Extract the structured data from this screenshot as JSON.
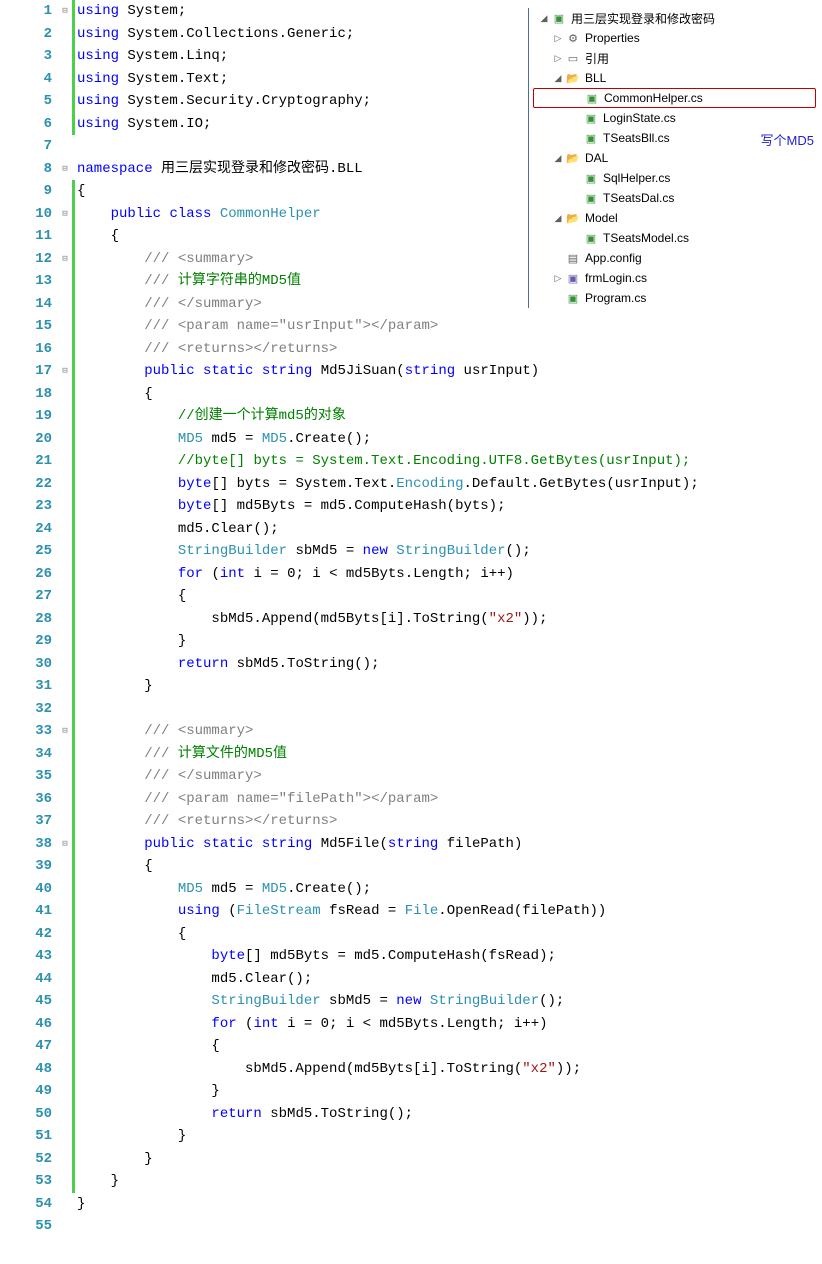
{
  "annotation": "写个MD5",
  "solution": {
    "project": "用三层实现登录和修改密码",
    "properties": "Properties",
    "references": "引用",
    "bll": "BLL",
    "bll_files": {
      "common_helper": "CommonHelper.cs",
      "login_state": "LoginState.cs",
      "tseats_bll": "TSeatsBll.cs"
    },
    "dal": "DAL",
    "dal_files": {
      "sql_helper": "SqlHelper.cs",
      "tseats_dal": "TSeatsDal.cs"
    },
    "model": "Model",
    "model_files": {
      "tseats_model": "TSeatsModel.cs"
    },
    "app_config": "App.config",
    "frm_login": "frmLogin.cs",
    "program": "Program.cs"
  },
  "code": {
    "lines": [
      {
        "n": 1,
        "fold": "⊟",
        "mod": true,
        "segs": [
          {
            "t": "using",
            "c": "kw"
          },
          {
            "t": " System;"
          }
        ]
      },
      {
        "n": 2,
        "fold": "│",
        "mod": true,
        "segs": [
          {
            "t": "using",
            "c": "kw"
          },
          {
            "t": " System.Collections.Generic;"
          }
        ]
      },
      {
        "n": 3,
        "fold": "│",
        "mod": true,
        "segs": [
          {
            "t": "using",
            "c": "kw"
          },
          {
            "t": " System.Linq;"
          }
        ]
      },
      {
        "n": 4,
        "fold": "│",
        "mod": true,
        "segs": [
          {
            "t": "using",
            "c": "kw"
          },
          {
            "t": " System.Text;"
          }
        ]
      },
      {
        "n": 5,
        "fold": "│",
        "mod": true,
        "segs": [
          {
            "t": "using",
            "c": "kw"
          },
          {
            "t": " System.Security.Cryptography;"
          }
        ]
      },
      {
        "n": 6,
        "fold": "└",
        "mod": true,
        "segs": [
          {
            "t": "using",
            "c": "kw"
          },
          {
            "t": " System.IO;"
          }
        ]
      },
      {
        "n": 7,
        "fold": "",
        "mod": false,
        "segs": []
      },
      {
        "n": 8,
        "fold": "⊟",
        "mod": false,
        "segs": [
          {
            "t": "namespace",
            "c": "kw"
          },
          {
            "t": " 用三层实现登录和修改密码.BLL"
          }
        ]
      },
      {
        "n": 9,
        "fold": "│",
        "mod": true,
        "segs": [
          {
            "t": "{"
          }
        ]
      },
      {
        "n": 10,
        "fold": "⊟",
        "mod": true,
        "segs": [
          {
            "t": "    "
          },
          {
            "t": "public",
            "c": "kw"
          },
          {
            "t": " "
          },
          {
            "t": "class",
            "c": "kw"
          },
          {
            "t": " "
          },
          {
            "t": "CommonHelper",
            "c": "type"
          }
        ]
      },
      {
        "n": 11,
        "fold": "│",
        "mod": true,
        "segs": [
          {
            "t": "    {"
          }
        ]
      },
      {
        "n": 12,
        "fold": "⊟",
        "mod": true,
        "segs": [
          {
            "t": "        "
          },
          {
            "t": "/// ",
            "c": "doc"
          },
          {
            "t": "<summary>",
            "c": "doc"
          }
        ]
      },
      {
        "n": 13,
        "fold": "│",
        "mod": true,
        "segs": [
          {
            "t": "        "
          },
          {
            "t": "/// ",
            "c": "doc"
          },
          {
            "t": "计算字符串的MD5值",
            "c": "cmt"
          }
        ]
      },
      {
        "n": 14,
        "fold": "│",
        "mod": true,
        "segs": [
          {
            "t": "        "
          },
          {
            "t": "/// ",
            "c": "doc"
          },
          {
            "t": "</summary>",
            "c": "doc"
          }
        ]
      },
      {
        "n": 15,
        "fold": "│",
        "mod": true,
        "segs": [
          {
            "t": "        "
          },
          {
            "t": "/// ",
            "c": "doc"
          },
          {
            "t": "<param name=\"",
            "c": "doc"
          },
          {
            "t": "usrInput",
            "c": "doc"
          },
          {
            "t": "\"></param>",
            "c": "doc"
          }
        ]
      },
      {
        "n": 16,
        "fold": "└",
        "mod": true,
        "segs": [
          {
            "t": "        "
          },
          {
            "t": "/// ",
            "c": "doc"
          },
          {
            "t": "<returns></returns>",
            "c": "doc"
          }
        ]
      },
      {
        "n": 17,
        "fold": "⊟",
        "mod": true,
        "segs": [
          {
            "t": "        "
          },
          {
            "t": "public",
            "c": "kw"
          },
          {
            "t": " "
          },
          {
            "t": "static",
            "c": "kw"
          },
          {
            "t": " "
          },
          {
            "t": "string",
            "c": "kw"
          },
          {
            "t": " Md5JiSuan("
          },
          {
            "t": "string",
            "c": "kw"
          },
          {
            "t": " usrInput)"
          }
        ]
      },
      {
        "n": 18,
        "fold": "│",
        "mod": true,
        "segs": [
          {
            "t": "        {"
          }
        ]
      },
      {
        "n": 19,
        "fold": "│",
        "mod": true,
        "segs": [
          {
            "t": "            "
          },
          {
            "t": "//创建一个计算md5的对象",
            "c": "cmt"
          }
        ]
      },
      {
        "n": 20,
        "fold": "│",
        "mod": true,
        "segs": [
          {
            "t": "            "
          },
          {
            "t": "MD5",
            "c": "type"
          },
          {
            "t": " md5 = "
          },
          {
            "t": "MD5",
            "c": "type"
          },
          {
            "t": ".Create();"
          }
        ]
      },
      {
        "n": 21,
        "fold": "│",
        "mod": true,
        "segs": [
          {
            "t": "            "
          },
          {
            "t": "//byte[] byts = System.Text.Encoding.UTF8.GetBytes(usrInput);",
            "c": "cmt"
          }
        ]
      },
      {
        "n": 22,
        "fold": "│",
        "mod": true,
        "segs": [
          {
            "t": "            "
          },
          {
            "t": "byte",
            "c": "kw"
          },
          {
            "t": "[] byts = System.Text."
          },
          {
            "t": "Encoding",
            "c": "type"
          },
          {
            "t": ".Default.GetBytes(usrInput);"
          }
        ]
      },
      {
        "n": 23,
        "fold": "│",
        "mod": true,
        "segs": [
          {
            "t": "            "
          },
          {
            "t": "byte",
            "c": "kw"
          },
          {
            "t": "[] md5Byts = md5.ComputeHash(byts);"
          }
        ]
      },
      {
        "n": 24,
        "fold": "│",
        "mod": true,
        "segs": [
          {
            "t": "            md5.Clear();"
          }
        ]
      },
      {
        "n": 25,
        "fold": "│",
        "mod": true,
        "segs": [
          {
            "t": "            "
          },
          {
            "t": "StringBuilder",
            "c": "type"
          },
          {
            "t": " sbMd5 = "
          },
          {
            "t": "new",
            "c": "kw"
          },
          {
            "t": " "
          },
          {
            "t": "StringBuilder",
            "c": "type"
          },
          {
            "t": "();"
          }
        ]
      },
      {
        "n": 26,
        "fold": "│",
        "mod": true,
        "segs": [
          {
            "t": "            "
          },
          {
            "t": "for",
            "c": "kw"
          },
          {
            "t": " ("
          },
          {
            "t": "int",
            "c": "kw"
          },
          {
            "t": " i = 0; i < md5Byts.Length; i++)"
          }
        ]
      },
      {
        "n": 27,
        "fold": "│",
        "mod": true,
        "segs": [
          {
            "t": "            {"
          }
        ]
      },
      {
        "n": 28,
        "fold": "│",
        "mod": true,
        "segs": [
          {
            "t": "                sbMd5.Append(md5Byts[i].ToString("
          },
          {
            "t": "\"x2\"",
            "c": "str"
          },
          {
            "t": "));"
          }
        ]
      },
      {
        "n": 29,
        "fold": "│",
        "mod": true,
        "segs": [
          {
            "t": "            }"
          }
        ]
      },
      {
        "n": 30,
        "fold": "│",
        "mod": true,
        "segs": [
          {
            "t": "            "
          },
          {
            "t": "return",
            "c": "kw"
          },
          {
            "t": " sbMd5.ToString();"
          }
        ]
      },
      {
        "n": 31,
        "fold": "│",
        "mod": true,
        "segs": [
          {
            "t": "        }"
          }
        ]
      },
      {
        "n": 32,
        "fold": "│",
        "mod": true,
        "segs": []
      },
      {
        "n": 33,
        "fold": "⊟",
        "mod": true,
        "segs": [
          {
            "t": "        "
          },
          {
            "t": "/// ",
            "c": "doc"
          },
          {
            "t": "<summary>",
            "c": "doc"
          }
        ]
      },
      {
        "n": 34,
        "fold": "│",
        "mod": true,
        "segs": [
          {
            "t": "        "
          },
          {
            "t": "/// ",
            "c": "doc"
          },
          {
            "t": "计算文件的MD5值",
            "c": "cmt"
          }
        ]
      },
      {
        "n": 35,
        "fold": "│",
        "mod": true,
        "segs": [
          {
            "t": "        "
          },
          {
            "t": "/// ",
            "c": "doc"
          },
          {
            "t": "</summary>",
            "c": "doc"
          }
        ]
      },
      {
        "n": 36,
        "fold": "│",
        "mod": true,
        "segs": [
          {
            "t": "        "
          },
          {
            "t": "/// ",
            "c": "doc"
          },
          {
            "t": "<param name=\"",
            "c": "doc"
          },
          {
            "t": "filePath",
            "c": "doc"
          },
          {
            "t": "\"></param>",
            "c": "doc"
          }
        ]
      },
      {
        "n": 37,
        "fold": "└",
        "mod": true,
        "segs": [
          {
            "t": "        "
          },
          {
            "t": "/// ",
            "c": "doc"
          },
          {
            "t": "<returns></returns>",
            "c": "doc"
          }
        ]
      },
      {
        "n": 38,
        "fold": "⊟",
        "mod": true,
        "segs": [
          {
            "t": "        "
          },
          {
            "t": "public",
            "c": "kw"
          },
          {
            "t": " "
          },
          {
            "t": "static",
            "c": "kw"
          },
          {
            "t": " "
          },
          {
            "t": "string",
            "c": "kw"
          },
          {
            "t": " Md5File("
          },
          {
            "t": "string",
            "c": "kw"
          },
          {
            "t": " filePath)"
          }
        ]
      },
      {
        "n": 39,
        "fold": "│",
        "mod": true,
        "segs": [
          {
            "t": "        {"
          }
        ]
      },
      {
        "n": 40,
        "fold": "│",
        "mod": true,
        "segs": [
          {
            "t": "            "
          },
          {
            "t": "MD5",
            "c": "type"
          },
          {
            "t": " md5 = "
          },
          {
            "t": "MD5",
            "c": "type"
          },
          {
            "t": ".Create();"
          }
        ]
      },
      {
        "n": 41,
        "fold": "│",
        "mod": true,
        "segs": [
          {
            "t": "            "
          },
          {
            "t": "using",
            "c": "kw"
          },
          {
            "t": " ("
          },
          {
            "t": "FileStream",
            "c": "type"
          },
          {
            "t": " fsRead = "
          },
          {
            "t": "File",
            "c": "type"
          },
          {
            "t": ".OpenRead(filePath))"
          }
        ]
      },
      {
        "n": 42,
        "fold": "│",
        "mod": true,
        "segs": [
          {
            "t": "            {"
          }
        ]
      },
      {
        "n": 43,
        "fold": "│",
        "mod": true,
        "segs": [
          {
            "t": "                "
          },
          {
            "t": "byte",
            "c": "kw"
          },
          {
            "t": "[] md5Byts = md5.ComputeHash(fsRead);"
          }
        ]
      },
      {
        "n": 44,
        "fold": "│",
        "mod": true,
        "segs": [
          {
            "t": "                md5.Clear();"
          }
        ]
      },
      {
        "n": 45,
        "fold": "│",
        "mod": true,
        "segs": [
          {
            "t": "                "
          },
          {
            "t": "StringBuilder",
            "c": "type"
          },
          {
            "t": " sbMd5 = "
          },
          {
            "t": "new",
            "c": "kw"
          },
          {
            "t": " "
          },
          {
            "t": "StringBuilder",
            "c": "type"
          },
          {
            "t": "();"
          }
        ]
      },
      {
        "n": 46,
        "fold": "│",
        "mod": true,
        "segs": [
          {
            "t": "                "
          },
          {
            "t": "for",
            "c": "kw"
          },
          {
            "t": " ("
          },
          {
            "t": "int",
            "c": "kw"
          },
          {
            "t": " i = 0; i < md5Byts.Length; i++)"
          }
        ]
      },
      {
        "n": 47,
        "fold": "│",
        "mod": true,
        "segs": [
          {
            "t": "                {"
          }
        ]
      },
      {
        "n": 48,
        "fold": "│",
        "mod": true,
        "segs": [
          {
            "t": "                    sbMd5.Append(md5Byts[i].ToString("
          },
          {
            "t": "\"x2\"",
            "c": "str"
          },
          {
            "t": "));"
          }
        ]
      },
      {
        "n": 49,
        "fold": "│",
        "mod": true,
        "segs": [
          {
            "t": "                }"
          }
        ]
      },
      {
        "n": 50,
        "fold": "│",
        "mod": true,
        "segs": [
          {
            "t": "                "
          },
          {
            "t": "return",
            "c": "kw"
          },
          {
            "t": " sbMd5.ToString();"
          }
        ]
      },
      {
        "n": 51,
        "fold": "│",
        "mod": true,
        "segs": [
          {
            "t": "            }"
          }
        ]
      },
      {
        "n": 52,
        "fold": "│",
        "mod": true,
        "segs": [
          {
            "t": "        }"
          }
        ]
      },
      {
        "n": 53,
        "fold": "│",
        "mod": true,
        "segs": [
          {
            "t": "    }"
          }
        ]
      },
      {
        "n": 54,
        "fold": "└",
        "mod": false,
        "segs": [
          {
            "t": "}"
          }
        ]
      },
      {
        "n": 55,
        "fold": "",
        "mod": false,
        "segs": []
      }
    ]
  }
}
